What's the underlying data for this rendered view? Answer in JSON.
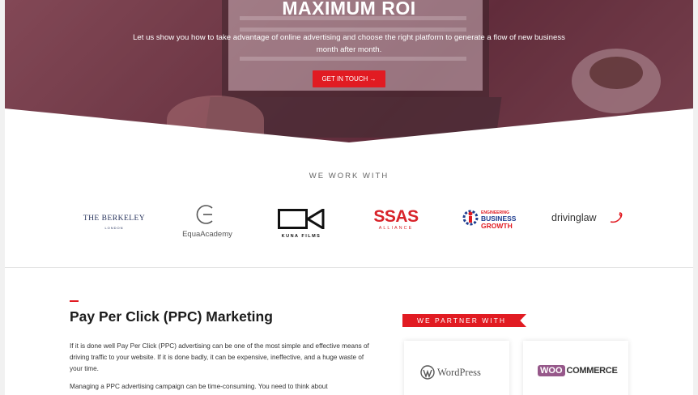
{
  "hero": {
    "title": "MAXIMUM ROI",
    "text": "Let us show you how to take advantage of online advertising and choose the right platform to generate a flow of new business month after month.",
    "cta_label": "GET IN TOUCH →"
  },
  "partners": {
    "title": "WE WORK WITH",
    "berkeley": {
      "name": "THE BERKELEY",
      "sub": "LONDON"
    },
    "equa": "EquaAcademy",
    "kuna": "KUNA FILMS",
    "ssas": {
      "main": "SSAS",
      "sub": "ALLIANCE"
    },
    "ebg": {
      "l1": "ENGINEERING",
      "l2": "BUSINESS",
      "l3": "GROWTH"
    },
    "driving": "drivinglaw"
  },
  "ppc": {
    "title": "Pay Per Click (PPC) Marketing",
    "p1": "If it is done well Pay Per Click (PPC) advertising can be one of the most simple and effective means of driving traffic to your website. If it is done badly, it can be expensive, ineffective, and a huge waste of your time.",
    "p2": "Managing a PPC advertising campaign can be time-consuming. You need to think about"
  },
  "partner_with": {
    "ribbon": "WE PARTNER WITH",
    "wordpress": "WordPress",
    "woo_bubble": "WOO",
    "woo_text": "COMMERCE"
  },
  "colors": {
    "accent": "#e11b22",
    "berkeley": "#27335c",
    "woo": "#96588a"
  }
}
